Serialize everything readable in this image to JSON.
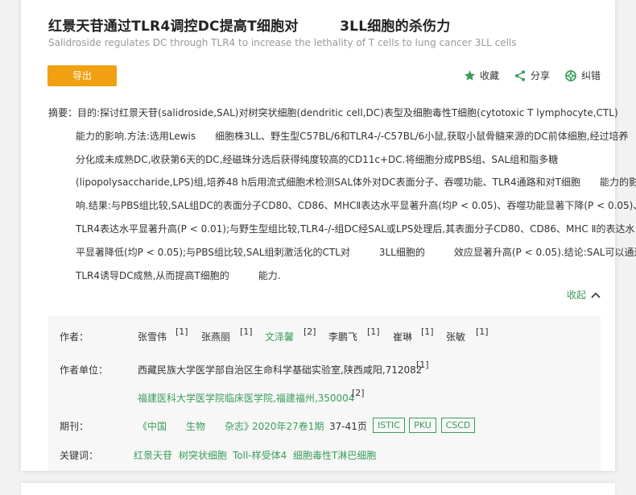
{
  "article": {
    "title": "红景天苷通过TLR4调控DC提高T细胞对　　　3LL细胞的杀伤力",
    "subtitle": "Salidroside regulates DC through TLR4 to increase the lethality of T cells to lung cancer 3LL cells"
  },
  "toolbar": {
    "export_label": "导出",
    "favorite_label": "收藏",
    "share_label": "分享",
    "report_label": "纠错"
  },
  "abstract": {
    "lines": [
      "摘要：目的:探讨红景天苷(salidroside,SAL)对树突状细胞(dendritic cell,DC)表型及细胞毒性T细胞(cytotoxic T lymphocyte,CTL)",
      "能力的影响.方法:选用Lewis　　细胞株3LL、野生型C57BL/6和TLR4-/-C57BL/6小鼠,获取小鼠骨髓来源的DC前体细胞,经过培养",
      "分化成未成熟DC,收获第6天的DC,经磁珠分选后获得纯度较高的CD11c+DC.将细胞分成PBS组、SAL组和脂多糖",
      "(lipopolysaccharide,LPS)组,培养48 h后用流式细胞术检测SAL体外对DC表面分子、吞噬功能、TLR4通路和对T细胞　　能力的影",
      "响.结果:与PBS组比较,SAL组DC的表面分子CD80、CD86、MHCⅡ表达水平显著升高(均P < 0.05)、吞噬功能显著下降(P < 0.05)、",
      "TLR4表达水平显著升高(P < 0.01);与野生型组比较,TLR4-/-组DC经SAL或LPS处理后,其表面分子CD80、CD86、MHC Ⅱ的表达水",
      "平显著降低(均P < 0.05);与PBS组比较,SAL组刺激活化的CTL对　　　3LL细胞的　　　效应显著升高(P < 0.05).结论:SAL可以通过调控",
      "TLR4诱导DC成熟,从而提高T细胞的　　　能力."
    ],
    "collapse_label": "收起"
  },
  "meta": {
    "authors_label": "作者：",
    "authors": [
      {
        "name": "张雪伟",
        "ref": "[1]"
      },
      {
        "name": "张燕丽",
        "ref": "[1]"
      },
      {
        "name": "文泽馨",
        "ref": "[2]"
      },
      {
        "name": "李鹏飞",
        "ref": "[1]"
      },
      {
        "name": "崔琳",
        "ref": "[1]"
      },
      {
        "name": "张敏",
        "ref": "[1]"
      }
    ],
    "affiliation_label": "作者单位：",
    "affiliations": [
      {
        "text": "西藏民族大学医学部自治区生命科学基础实验室,陕西咸阳,712082",
        "ref": "[1]"
      },
      {
        "text": "福建医科大学医学院临床医学院,福建福州,350004",
        "ref": "[2]"
      }
    ],
    "journal_label": "期刊：",
    "journal_name": "《中国　　生物　　杂志》",
    "journal_issue": "2020年27卷1期",
    "pages": "37-41页",
    "tags": [
      "ISTIC",
      "PKU",
      "CSCD"
    ],
    "keywords_label": "关键词：",
    "keywords": [
      "红景天苷",
      "树突状细胞",
      "Toll-样受体4",
      "细胞毒性T淋巴细胞"
    ]
  },
  "colors": {
    "accent_green": "#3a9c5a",
    "export_orange": "#f0a010"
  },
  "icons": [
    "star-icon",
    "share-icon",
    "lifebuoy-icon",
    "chevron-up-icon"
  ]
}
